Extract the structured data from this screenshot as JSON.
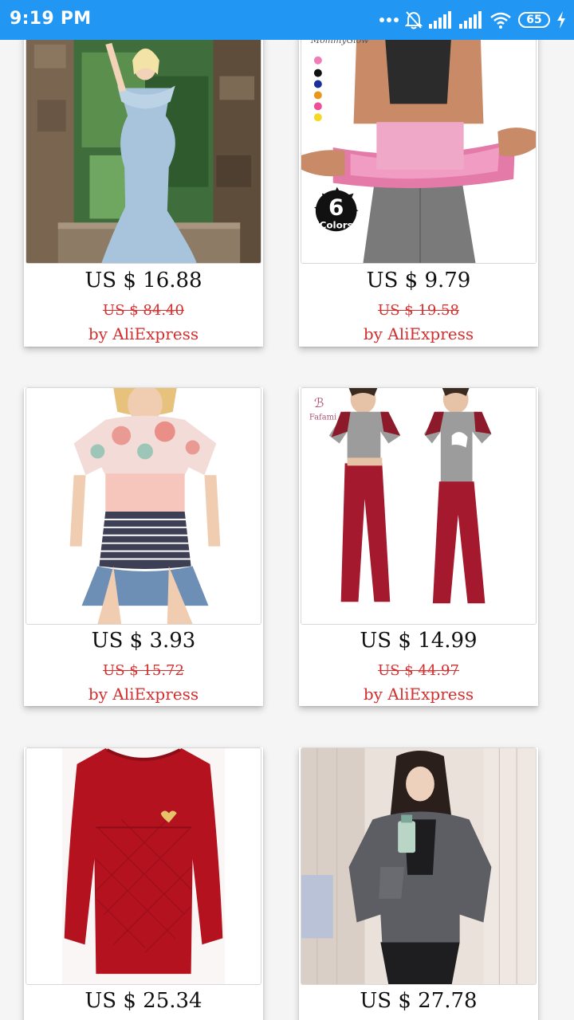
{
  "status_bar": {
    "time": "9:19 PM",
    "battery": "65",
    "icons": [
      "more-dots-icon",
      "bell-off-icon",
      "signal-icon",
      "signal-icon",
      "wifi-icon",
      "battery-icon",
      "charging-icon"
    ]
  },
  "products": [
    {
      "image_icon": "maternity-dress-photo",
      "price": "US $ 16.88",
      "old_price": "US $ 84.40",
      "seller": "by AliExpress"
    },
    {
      "image_icon": "waist-trainer-photo",
      "image_brand": "MommyGlow",
      "image_badge_number": "6",
      "image_badge_text": "Colors",
      "price": "US $ 9.79",
      "old_price": "US $ 19.58",
      "seller": "by AliExpress"
    },
    {
      "image_icon": "floral-tshirt-photo",
      "price": "US $ 3.93",
      "old_price": "US $ 15.72",
      "seller": "by AliExpress"
    },
    {
      "image_icon": "pajama-set-photo",
      "image_brand": "Fafami",
      "price": "US $ 14.99",
      "old_price": "US $ 44.97",
      "seller": "by AliExpress"
    },
    {
      "image_icon": "red-sweater-photo",
      "price": "US $ 25.34"
    },
    {
      "image_icon": "grey-hoodie-photo",
      "price": "US $ 27.78"
    }
  ],
  "colors": {
    "status_bar": "#2196f3",
    "sale_red": "#d32f2f",
    "background": "#f5f5f5"
  }
}
